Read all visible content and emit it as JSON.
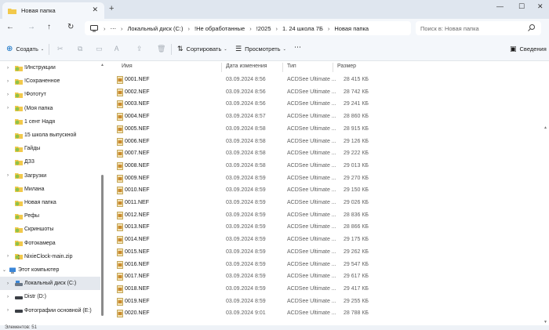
{
  "window": {
    "tab_title": "Новая папка",
    "close_tab": "✕",
    "new_tab": "+",
    "minimize": "—",
    "maximize": "☐",
    "close": "✕"
  },
  "address": {
    "crumbs": [
      "Локальный диск (C:)",
      "!Не обработанные",
      "!2025",
      "1. 24 школа 7Б",
      "Новая папка"
    ],
    "ellipsis": "⋯",
    "search_placeholder": "Поиск в: Новая папка"
  },
  "toolbar": {
    "create": "Создать",
    "sort": "Сортировать",
    "view": "Просмотреть",
    "more": "⋯",
    "details": "Сведения"
  },
  "sidebar": {
    "items": [
      {
        "label": "!Инструкции",
        "chev": true,
        "icon": "folder-green"
      },
      {
        "label": "!Сохраненное",
        "chev": true,
        "icon": "folder-green"
      },
      {
        "label": "!Фототут",
        "chev": true,
        "icon": "folder-green"
      },
      {
        "label": "(Моя папка",
        "chev": true,
        "icon": "folder-green"
      },
      {
        "label": "1 сент Надя",
        "chev": false,
        "icon": "folder-green"
      },
      {
        "label": "15 школа выпускной",
        "chev": false,
        "icon": "folder-green"
      },
      {
        "label": "Гайды",
        "chev": false,
        "icon": "folder-green"
      },
      {
        "label": "ДЗ3",
        "chev": false,
        "icon": "folder-green"
      },
      {
        "label": "Загрузки",
        "chev": true,
        "icon": "folder-green"
      },
      {
        "label": "Милана",
        "chev": false,
        "icon": "folder-green"
      },
      {
        "label": "Новая папка",
        "chev": false,
        "icon": "folder-green"
      },
      {
        "label": "Рефы",
        "chev": false,
        "icon": "folder-green"
      },
      {
        "label": "Скриншоты",
        "chev": false,
        "icon": "folder-green"
      },
      {
        "label": "Фотокамера",
        "chev": false,
        "icon": "folder-green"
      },
      {
        "label": "NixieClock-main.zip",
        "chev": true,
        "icon": "zip"
      },
      {
        "label": "Этот компьютер",
        "chev": true,
        "icon": "computer",
        "expanded": true
      },
      {
        "label": "Локальный диск (C:)",
        "chev": true,
        "icon": "drive-c",
        "selected": true
      },
      {
        "label": "Distr (D:)",
        "chev": true,
        "icon": "drive"
      },
      {
        "label": "Фотографии основной (E:)",
        "chev": true,
        "icon": "drive"
      }
    ]
  },
  "columns": {
    "name": "Имя",
    "date": "Дата изменения",
    "type": "Тип",
    "size": "Размер"
  },
  "files": [
    {
      "name": "0001.NEF",
      "date": "03.09.2024 8:56",
      "type": "ACDSee Ultimate ...",
      "size": "28 415 КБ"
    },
    {
      "name": "0002.NEF",
      "date": "03.09.2024 8:56",
      "type": "ACDSee Ultimate ...",
      "size": "28 742 КБ"
    },
    {
      "name": "0003.NEF",
      "date": "03.09.2024 8:56",
      "type": "ACDSee Ultimate ...",
      "size": "29 241 КБ"
    },
    {
      "name": "0004.NEF",
      "date": "03.09.2024 8:57",
      "type": "ACDSee Ultimate ...",
      "size": "28 860 КБ"
    },
    {
      "name": "0005.NEF",
      "date": "03.09.2024 8:58",
      "type": "ACDSee Ultimate ...",
      "size": "28 915 КБ"
    },
    {
      "name": "0006.NEF",
      "date": "03.09.2024 8:58",
      "type": "ACDSee Ultimate ...",
      "size": "29 126 КБ"
    },
    {
      "name": "0007.NEF",
      "date": "03.09.2024 8:58",
      "type": "ACDSee Ultimate ...",
      "size": "29 222 КБ"
    },
    {
      "name": "0008.NEF",
      "date": "03.09.2024 8:58",
      "type": "ACDSee Ultimate ...",
      "size": "29 013 КБ"
    },
    {
      "name": "0009.NEF",
      "date": "03.09.2024 8:59",
      "type": "ACDSee Ultimate ...",
      "size": "29 270 КБ"
    },
    {
      "name": "0010.NEF",
      "date": "03.09.2024 8:59",
      "type": "ACDSee Ultimate ...",
      "size": "29 150 КБ"
    },
    {
      "name": "0011.NEF",
      "date": "03.09.2024 8:59",
      "type": "ACDSee Ultimate ...",
      "size": "29 026 КБ"
    },
    {
      "name": "0012.NEF",
      "date": "03.09.2024 8:59",
      "type": "ACDSee Ultimate ...",
      "size": "28 836 КБ"
    },
    {
      "name": "0013.NEF",
      "date": "03.09.2024 8:59",
      "type": "ACDSee Ultimate ...",
      "size": "28 866 КБ"
    },
    {
      "name": "0014.NEF",
      "date": "03.09.2024 8:59",
      "type": "ACDSee Ultimate ...",
      "size": "29 175 КБ"
    },
    {
      "name": "0015.NEF",
      "date": "03.09.2024 8:59",
      "type": "ACDSee Ultimate ...",
      "size": "29 262 КБ"
    },
    {
      "name": "0016.NEF",
      "date": "03.09.2024 8:59",
      "type": "ACDSee Ultimate ...",
      "size": "29 547 КБ"
    },
    {
      "name": "0017.NEF",
      "date": "03.09.2024 8:59",
      "type": "ACDSee Ultimate ...",
      "size": "29 617 КБ"
    },
    {
      "name": "0018.NEF",
      "date": "03.09.2024 8:59",
      "type": "ACDSee Ultimate ...",
      "size": "29 417 КБ"
    },
    {
      "name": "0019.NEF",
      "date": "03.09.2024 8:59",
      "type": "ACDSee Ultimate ...",
      "size": "29 255 КБ"
    },
    {
      "name": "0020.NEF",
      "date": "03.09.2024 9:01",
      "type": "ACDSee Ultimate ...",
      "size": "28 788 КБ"
    }
  ],
  "status": {
    "items_count": "Элементов: 51"
  },
  "colors": {
    "folder_green": "#8fc24a",
    "folder_yellow": "#f2c94c",
    "selected_row": "#e4e8ee",
    "accent": "#0067c0"
  }
}
